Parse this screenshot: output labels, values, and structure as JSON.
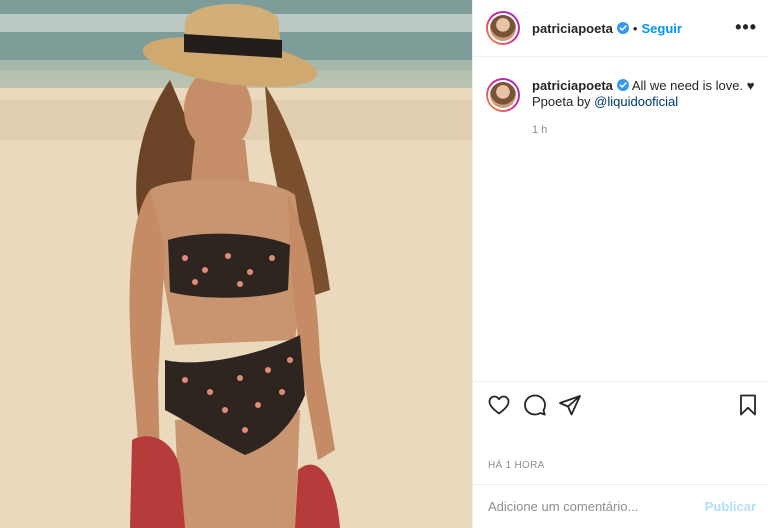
{
  "post": {
    "username": "patriciapoeta",
    "follow_label": "Seguir",
    "separator": "•",
    "more_label": "•••"
  },
  "caption": {
    "username": "patriciapoeta",
    "text_line1": "All we need is love. ♥",
    "text_line2_prefix": "Ppoeta by ",
    "mention": "@liquidooficial",
    "time": "1 h"
  },
  "actions": {
    "like_icon": "heart-icon",
    "comment_icon": "comment-icon",
    "share_icon": "share-icon",
    "save_icon": "bookmark-icon"
  },
  "post_time": "HÁ 1 HORA",
  "comment": {
    "placeholder": "Adicione um comentário...",
    "publish_label": "Publicar"
  },
  "colors": {
    "accent": "#0095f6",
    "verified": "#3897f0",
    "publish_disabled": "#b2dffc",
    "muted": "#8e8e8e"
  }
}
